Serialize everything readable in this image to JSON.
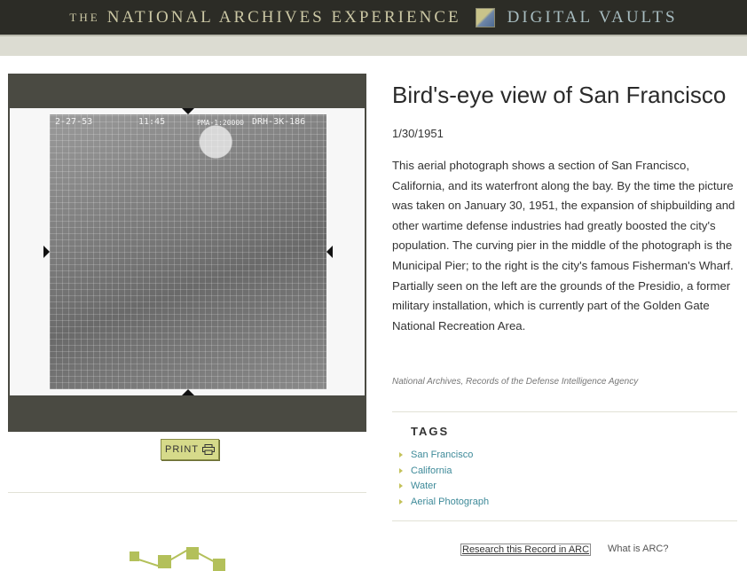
{
  "header": {
    "prefix": "THE",
    "brand": "NATIONAL ARCHIVES EXPERIENCE",
    "section": "DIGITAL VAULTS"
  },
  "photo": {
    "caption_date": "2-27-53",
    "caption_time": "11:45",
    "caption_scale": "PMA-1:20000",
    "caption_id": "DRH-3K-186"
  },
  "print_label": "PRINT",
  "record": {
    "title": "Bird's-eye view of San Francisco",
    "date": "1/30/1951",
    "description": "This aerial photograph shows a section of San Francisco, California, and its waterfront along the bay. By the time the picture was taken on January 30, 1951, the expansion of shipbuilding and other wartime defense industries had greatly boosted the city's population. The curving pier in the middle of the photograph is the Municipal Pier; to the right is the city's famous Fisherman's Wharf. Partially seen on the left are the grounds of the Presidio, a former military installation, which is currently part of the Golden Gate National Recreation Area.",
    "credit": "National Archives, Records of the Defense Intelligence Agency"
  },
  "tags": {
    "heading": "TAGS",
    "items": [
      "San Francisco",
      "California",
      "Water",
      "Aerial Photograph"
    ]
  },
  "arc": {
    "research_link": "Research this Record in ARC",
    "what_link": "What is ARC?"
  },
  "icons": [
    "logo-icon",
    "printer-icon",
    "tag-arrow-icon"
  ],
  "colors": {
    "header_bg": "#2c2c26",
    "header_text": "#cbc7a4",
    "accent_green": "#b3c05a",
    "link_teal": "#3e8a99"
  }
}
